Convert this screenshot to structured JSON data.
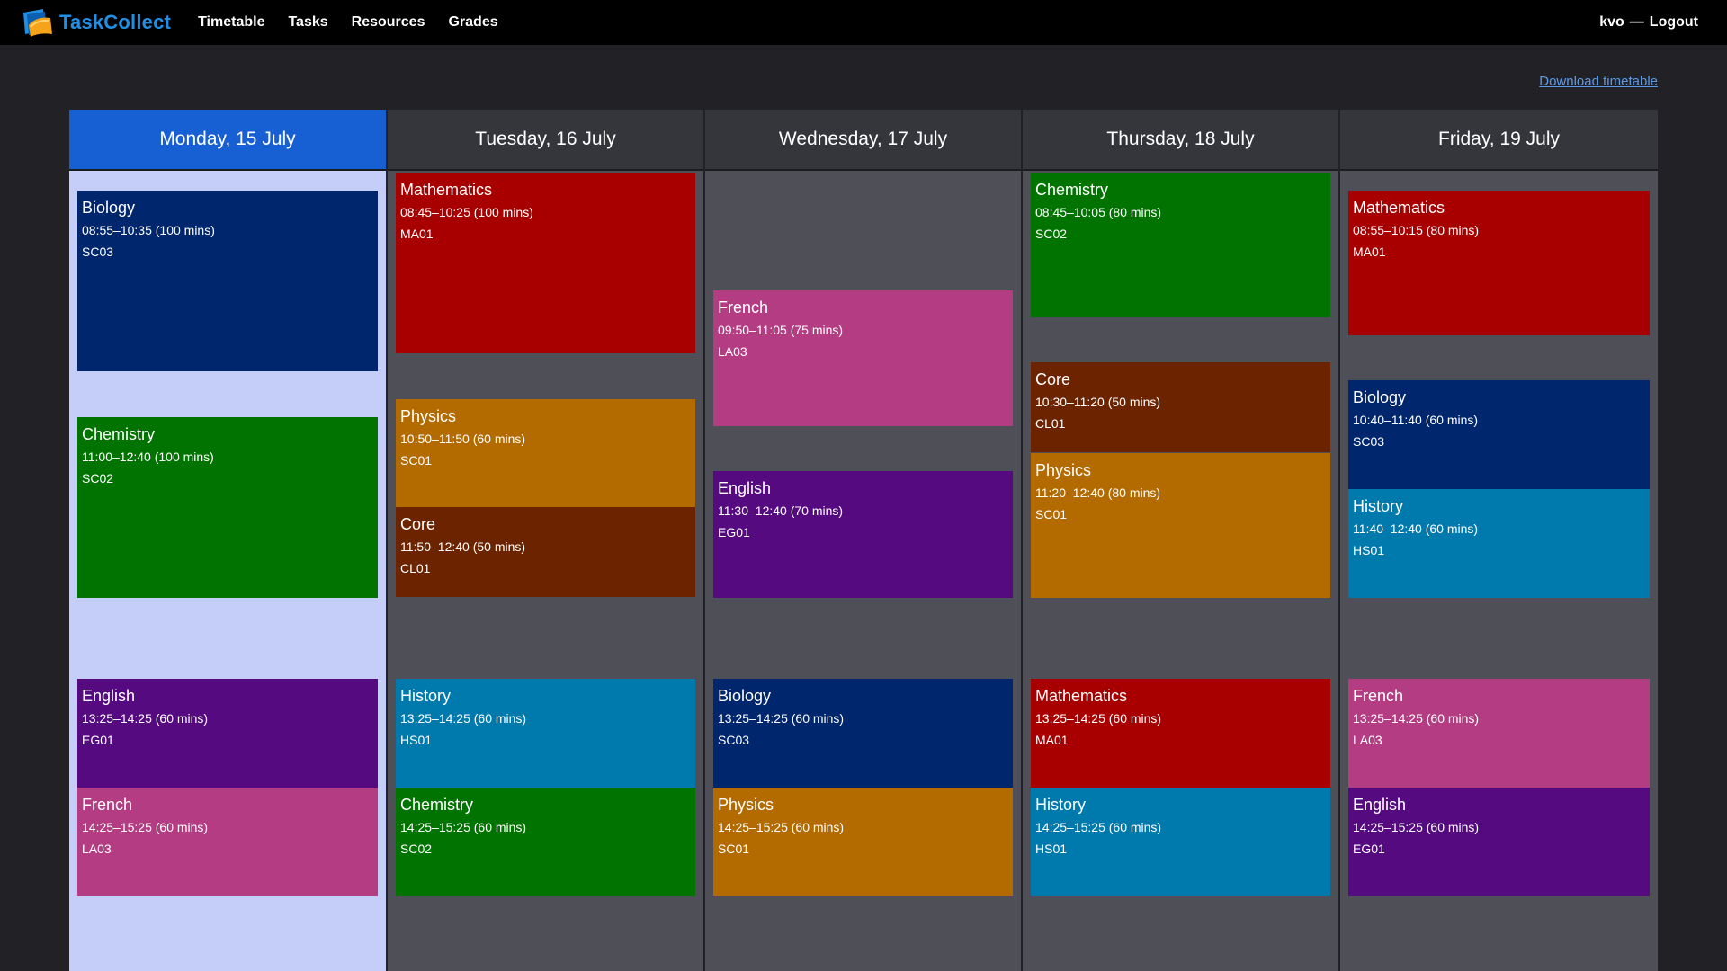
{
  "nav": {
    "brand": "TaskCollect",
    "links": [
      "Timetable",
      "Tasks",
      "Resources",
      "Grades"
    ],
    "user": "kvo",
    "separator": "—",
    "logout": "Logout"
  },
  "download_label": "Download timetable",
  "colors": {
    "Mathematics": "#a80000",
    "Biology": "#00266d",
    "Chemistry": "#007300",
    "English": "#550a80",
    "French": "#b43c82",
    "Physics": "#b36b00",
    "Core": "#6b2300",
    "History": "#007aad"
  },
  "days": [
    {
      "label": "Monday, 15 July",
      "today": true,
      "lessons": [
        {
          "subject": "Biology",
          "time": "08:55–10:35 (100 mins)",
          "room": "SC03"
        },
        {
          "subject": "Chemistry",
          "time": "11:00–12:40 (100 mins)",
          "room": "SC02"
        },
        {
          "subject": "English",
          "time": "13:25–14:25 (60 mins)",
          "room": "EG01"
        },
        {
          "subject": "French",
          "time": "14:25–15:25 (60 mins)",
          "room": "LA03"
        }
      ]
    },
    {
      "label": "Tuesday, 16 July",
      "today": false,
      "lessons": [
        {
          "subject": "Mathematics",
          "time": "08:45–10:25 (100 mins)",
          "room": "MA01"
        },
        {
          "subject": "Physics",
          "time": "10:50–11:50 (60 mins)",
          "room": "SC01"
        },
        {
          "subject": "Core",
          "time": "11:50–12:40 (50 mins)",
          "room": "CL01"
        },
        {
          "subject": "History",
          "time": "13:25–14:25 (60 mins)",
          "room": "HS01"
        },
        {
          "subject": "Chemistry",
          "time": "14:25–15:25 (60 mins)",
          "room": "SC02"
        }
      ]
    },
    {
      "label": "Wednesday, 17 July",
      "today": false,
      "lessons": [
        {
          "subject": "French",
          "time": "09:50–11:05 (75 mins)",
          "room": "LA03"
        },
        {
          "subject": "English",
          "time": "11:30–12:40 (70 mins)",
          "room": "EG01"
        },
        {
          "subject": "Biology",
          "time": "13:25–14:25 (60 mins)",
          "room": "SC03"
        },
        {
          "subject": "Physics",
          "time": "14:25–15:25 (60 mins)",
          "room": "SC01"
        }
      ]
    },
    {
      "label": "Thursday, 18 July",
      "today": false,
      "lessons": [
        {
          "subject": "Chemistry",
          "time": "08:45–10:05 (80 mins)",
          "room": "SC02"
        },
        {
          "subject": "Core",
          "time": "10:30–11:20 (50 mins)",
          "room": "CL01"
        },
        {
          "subject": "Physics",
          "time": "11:20–12:40 (80 mins)",
          "room": "SC01"
        },
        {
          "subject": "Mathematics",
          "time": "13:25–14:25 (60 mins)",
          "room": "MA01"
        },
        {
          "subject": "History",
          "time": "14:25–15:25 (60 mins)",
          "room": "HS01"
        }
      ]
    },
    {
      "label": "Friday, 19 July",
      "today": false,
      "lessons": [
        {
          "subject": "Mathematics",
          "time": "08:55–10:15 (80 mins)",
          "room": "MA01"
        },
        {
          "subject": "Biology",
          "time": "10:40–11:40 (60 mins)",
          "room": "SC03"
        },
        {
          "subject": "History",
          "time": "11:40–12:40 (60 mins)",
          "room": "HS01"
        },
        {
          "subject": "French",
          "time": "13:25–14:25 (60 mins)",
          "room": "LA03"
        },
        {
          "subject": "English",
          "time": "14:25–15:25 (60 mins)",
          "room": "EG01"
        }
      ]
    }
  ]
}
